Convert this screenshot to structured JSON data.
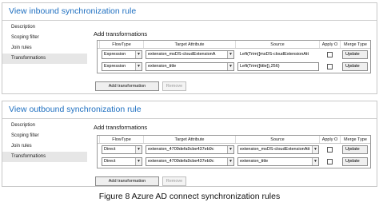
{
  "caption": "Figure 8 Azure AD connect synchronization rules",
  "inbound": {
    "title": "View inbound synchronization rule",
    "nav": [
      "Description",
      "Scoping filter",
      "Join rules",
      "Transformations"
    ],
    "section_title": "Add transformations",
    "columns": [
      "FlowType",
      "Target Attribute",
      "Source",
      "Apply O",
      "Merge Type"
    ],
    "rows": [
      {
        "flow": "Expression",
        "target": "extension_msDS-cloudExtensionA",
        "source": "Left(Trim([msDS-cloudExtensionAtt",
        "merge": "Update"
      },
      {
        "flow": "Expression",
        "target": "extension_title",
        "source": "Left(Trim([title]),256)",
        "merge": "Update"
      }
    ],
    "add_button": "Add transformation",
    "remove_button": "Remove"
  },
  "outbound": {
    "title": "View outbound synchronization rule",
    "nav": [
      "Description",
      "Scoping filter",
      "Join rules",
      "Transformations"
    ],
    "section_title": "Add transformations",
    "columns": [
      "FlowType",
      "Target Attribute",
      "Source",
      "Apply O",
      "Merge Type"
    ],
    "rows": [
      {
        "flow": "Direct",
        "target": "extension_4709defa9cbe437eb9c",
        "source": "extension_msDS-cloudExtensionAtt",
        "merge": "Update"
      },
      {
        "flow": "Direct",
        "target": "extension_4709defa9cbe437eb9c",
        "source": "extension_title",
        "merge": "Update"
      }
    ],
    "add_button": "Add transformation",
    "remove_button": "Remove"
  },
  "icons": {
    "dropdown": "chevron-down-icon"
  }
}
